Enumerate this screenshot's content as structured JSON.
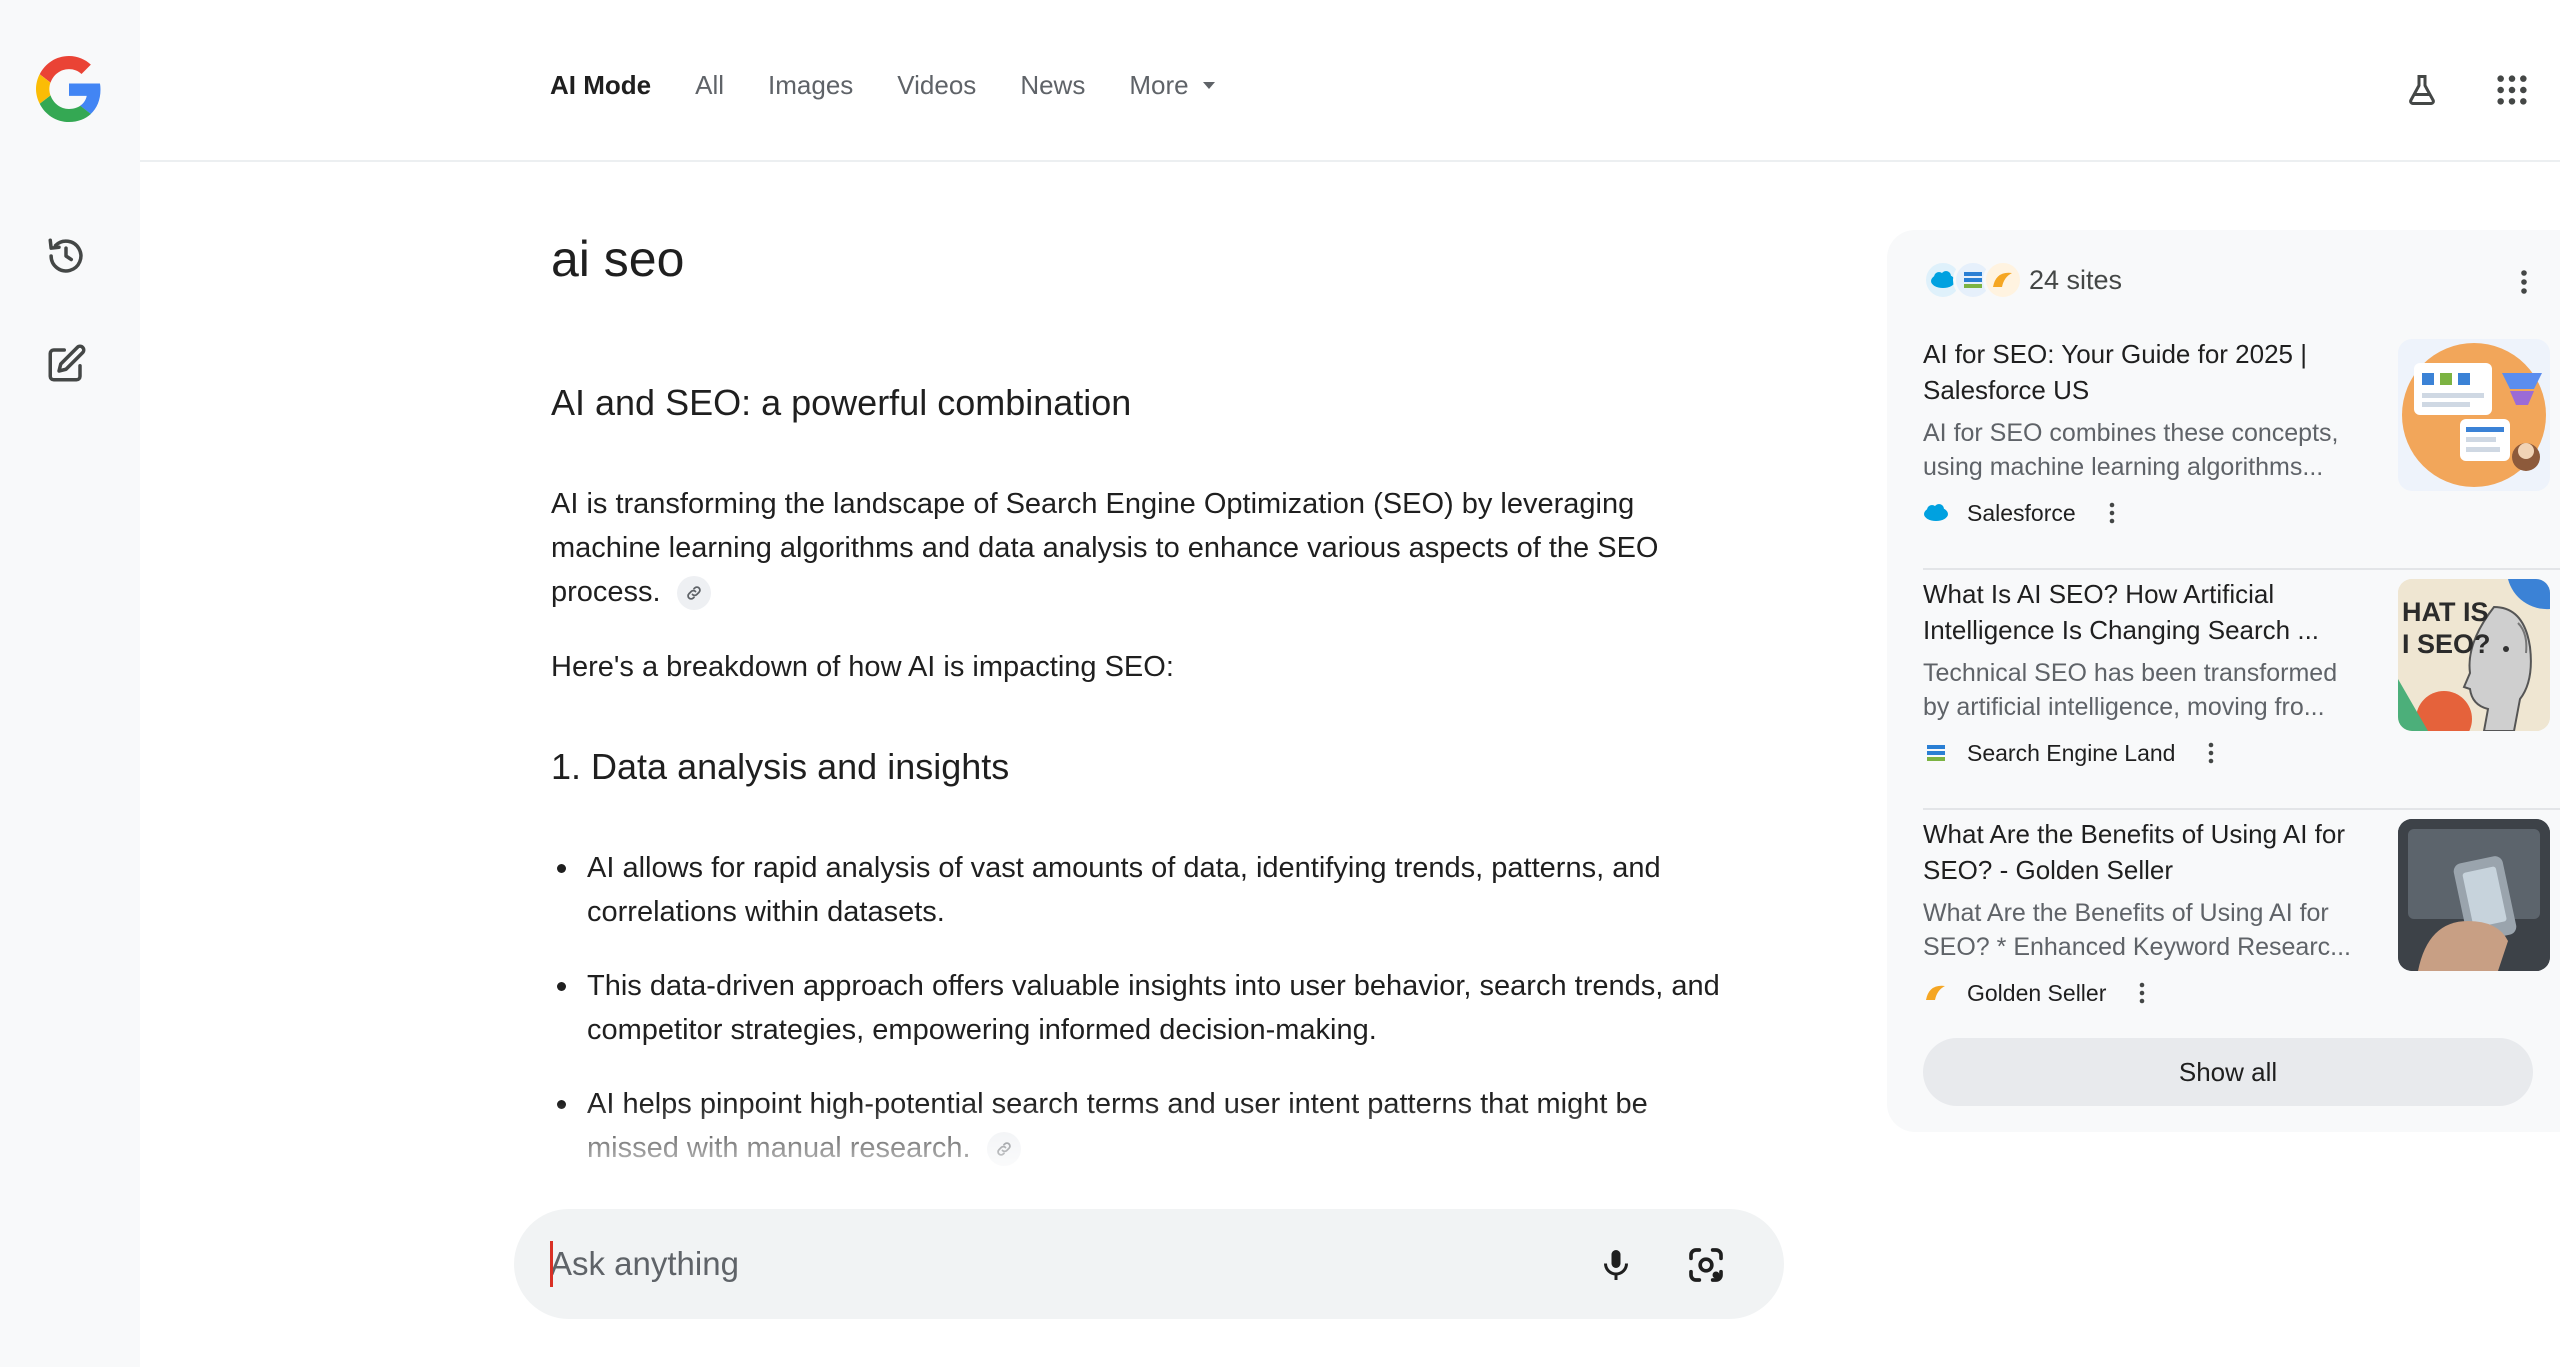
{
  "nav": {
    "tabs": [
      {
        "label": "AI Mode",
        "active": true
      },
      {
        "label": "All"
      },
      {
        "label": "Images"
      },
      {
        "label": "Videos"
      },
      {
        "label": "News"
      },
      {
        "label": "More"
      }
    ],
    "icons": [
      "flask-icon",
      "apps-grid-icon"
    ]
  },
  "rail": {
    "icons": [
      "google-logo",
      "history-icon",
      "new-chat-icon"
    ]
  },
  "main": {
    "query": "ai seo",
    "heading": "AI and SEO: a powerful combination",
    "paragraph1": "AI is transforming the landscape of Search Engine Optimization (SEO) by leveraging machine learning algorithms and data analysis to enhance various aspects of the SEO process.",
    "paragraph2": "Here's a breakdown of how AI is impacting SEO:",
    "section_heading": "1. Data analysis and insights",
    "bullets": [
      "AI allows for rapid analysis of vast amounts of data, identifying trends, patterns, and correlations within datasets.",
      "This data-driven approach offers valuable insights into user behavior, search trends, and competitor strategies, empowering informed decision-making.",
      "AI helps pinpoint high-potential search terms and user intent patterns that might be missed with manual research."
    ]
  },
  "ask": {
    "placeholder": "Ask anything"
  },
  "sources": {
    "count_label": "24 sites",
    "cards": [
      {
        "title": "AI for SEO: Your Guide for 2025 | Salesforce US",
        "snippet": "AI for SEO combines these concepts, using machine learning algorithms...",
        "site": "Salesforce"
      },
      {
        "title": "What Is AI SEO? How Artificial Intelligence Is Changing Search ...",
        "snippet": "Technical SEO has been transformed by artificial intelligence, moving fro...",
        "site": "Search Engine Land",
        "thumb_text": "HAT IS\nI SEO?"
      },
      {
        "title": "What Are the Benefits of Using AI for SEO? - Golden Seller",
        "snippet": "What Are the Benefits of Using AI for SEO? * Enhanced Keyword Researc...",
        "site": "Golden Seller"
      }
    ],
    "show_all_label": "Show all"
  },
  "colors": {
    "salesforce_blue": "#00a1e0",
    "golden_orange": "#f5a623",
    "sel_blue": "#2a7fd4",
    "accent_red": "#d93025"
  }
}
